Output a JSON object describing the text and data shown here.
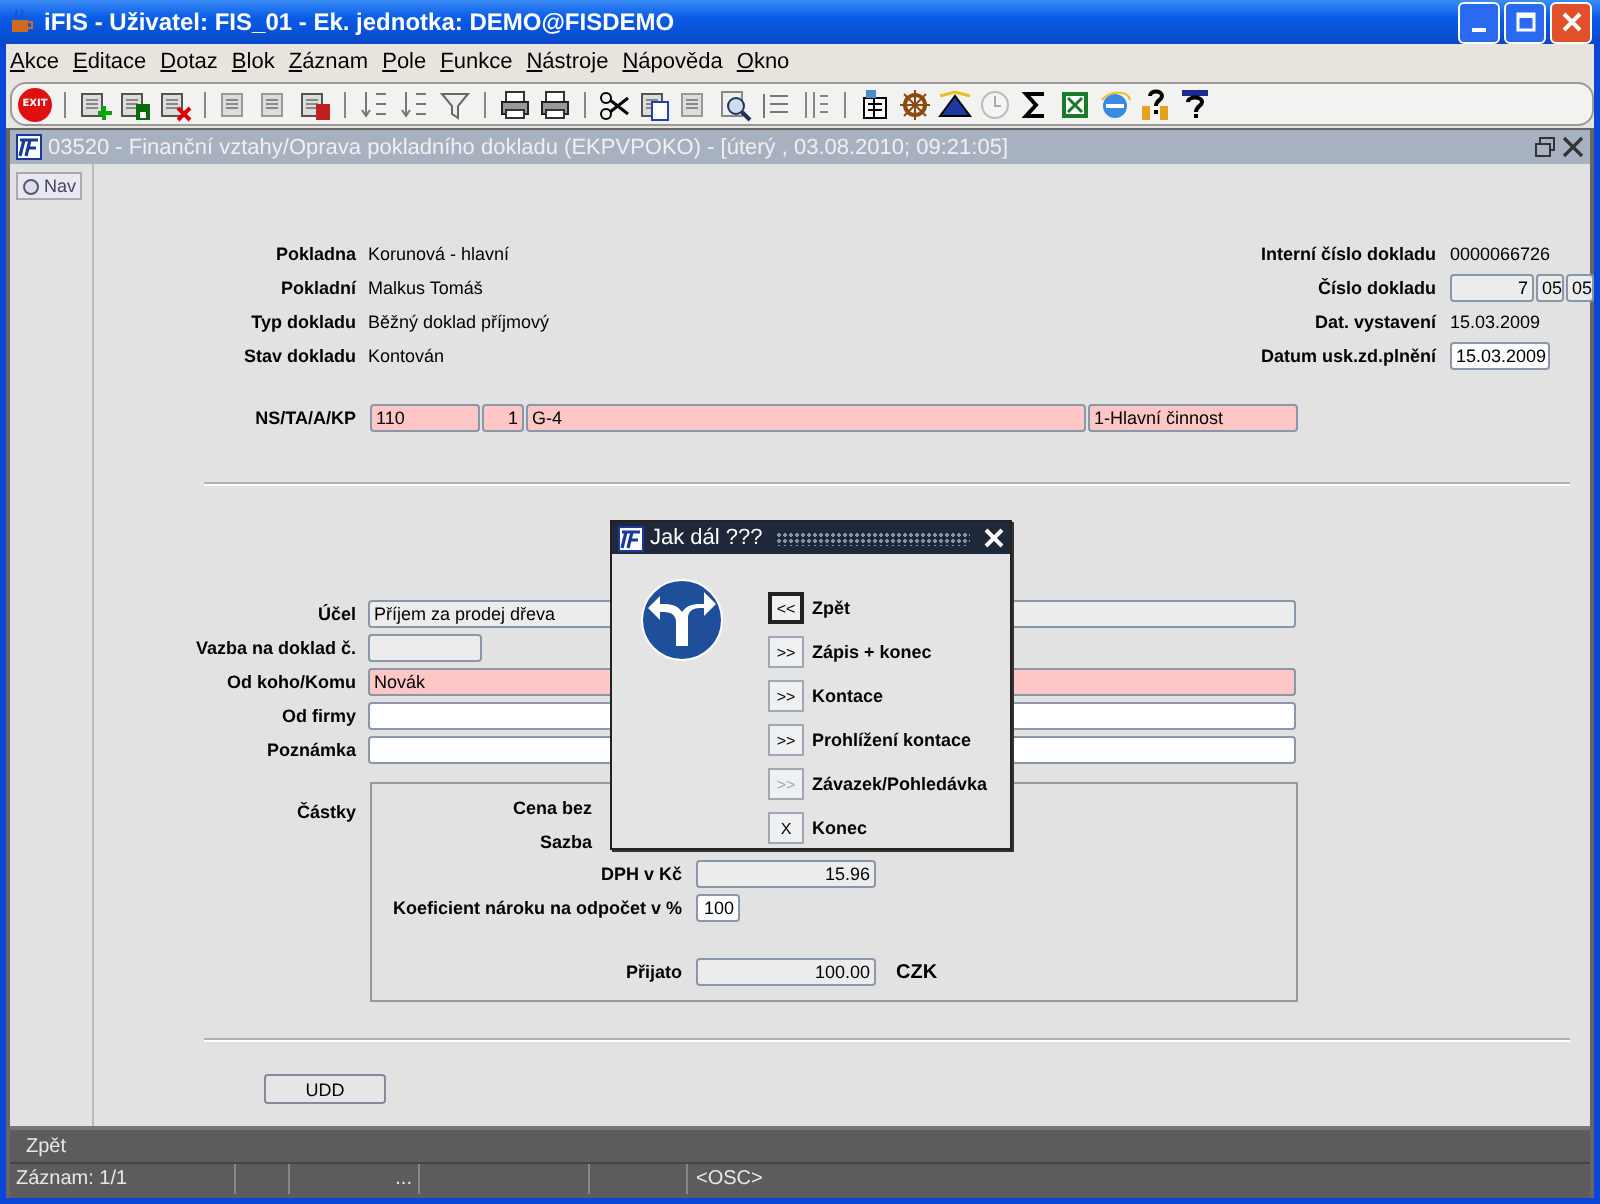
{
  "window": {
    "title": "iFIS - Uživatel: FIS_01 - Ek. jednotka: DEMO@FISDEMO"
  },
  "menu": [
    "Akce",
    "Editace",
    "Dotaz",
    "Blok",
    "Záznam",
    "Pole",
    "Funkce",
    "Nástroje",
    "Nápověda",
    "Okno"
  ],
  "toolbar": {
    "exit_label": "EXIT"
  },
  "form_window": {
    "title": "03520 - Finanční vztahy/Oprava pokladního dokladu (EKPVPOKO) - [úterý , 03.08.2010; 09:21:05]"
  },
  "nav_tab": {
    "label": "Nav"
  },
  "header_left": [
    {
      "label": "Pokladna",
      "value": "Korunová - hlavní"
    },
    {
      "label": "Pokladní",
      "value": "Malkus Tomáš"
    },
    {
      "label": "Typ dokladu",
      "value": "Běžný doklad příjmový"
    },
    {
      "label": "Stav dokladu",
      "value": "Kontován"
    }
  ],
  "header_right": [
    {
      "label": "Interní číslo dokladu",
      "fields": [
        {
          "value": "0000066726",
          "kind": "text"
        }
      ]
    },
    {
      "label": "Číslo dokladu",
      "fields": [
        {
          "value": "7",
          "kind": "readonly"
        },
        {
          "value": "05",
          "kind": "readonly"
        },
        {
          "value": "05",
          "kind": "readonly"
        }
      ]
    },
    {
      "label": "Dat. vystavení",
      "fields": [
        {
          "value": "15.03.2009",
          "kind": "text"
        }
      ]
    },
    {
      "label": "Datum usk.zd.plnění",
      "fields": [
        {
          "value": "15.03.2009",
          "kind": "editable"
        }
      ]
    }
  ],
  "assignment": {
    "label": "NS/TA/A/KP",
    "fields": [
      {
        "value": "110",
        "kind": "required"
      },
      {
        "value": "1",
        "kind": "required"
      },
      {
        "value": "G-4",
        "kind": "required"
      },
      {
        "value": "1-Hlavní činnost",
        "kind": "required"
      }
    ]
  },
  "details": [
    {
      "label": "Účel",
      "field": {
        "value": "Příjem za prodej dřeva",
        "kind": "readonly"
      }
    },
    {
      "label": "Vazba na doklad č.",
      "field": {
        "kind": "readonly"
      }
    },
    {
      "label": "Od koho/Komu",
      "field": {
        "value": "Novák",
        "kind": "required"
      }
    },
    {
      "label": "Od firmy",
      "field": {
        "kind": "editable"
      }
    },
    {
      "label": "Poznámka",
      "field": {
        "kind": "editable"
      }
    }
  ],
  "amounts": {
    "label": "Částky",
    "rows": [
      {
        "label": "Cena bez"
      },
      {
        "label": "Sazba"
      },
      {
        "label": "DPH v Kč",
        "field": {
          "value": "15.96",
          "kind": "readonly"
        }
      },
      {
        "label": "Koeficient nároku na odpočet v %",
        "field": {
          "value": "100",
          "kind": "editable"
        }
      },
      {
        "label": "Přijato",
        "field": {
          "value": "100.00",
          "kind": "readonly"
        },
        "unit": "CZK"
      }
    ]
  },
  "udd_button": "UDD",
  "dialog": {
    "title": "Jak dál ???",
    "buttons": [
      {
        "symbol": "<<",
        "label": "Zpět",
        "focused": true,
        "disabled": false
      },
      {
        "symbol": ">>",
        "label": "Zápis + konec",
        "focused": false,
        "disabled": false
      },
      {
        "symbol": ">>",
        "label": "Kontace",
        "focused": false,
        "disabled": false
      },
      {
        "symbol": ">>",
        "label": "Prohlížení kontace",
        "focused": false,
        "disabled": false
      },
      {
        "symbol": ">>",
        "label": "Závazek/Pohledávka",
        "focused": false,
        "disabled": true
      },
      {
        "symbol": "X",
        "label": "Konec",
        "focused": false,
        "disabled": false
      }
    ]
  },
  "status_bar": {
    "message": "Zpět",
    "record": "Záznam: 1/1",
    "cell_3": "...",
    "cell_6": "<OSC>"
  }
}
